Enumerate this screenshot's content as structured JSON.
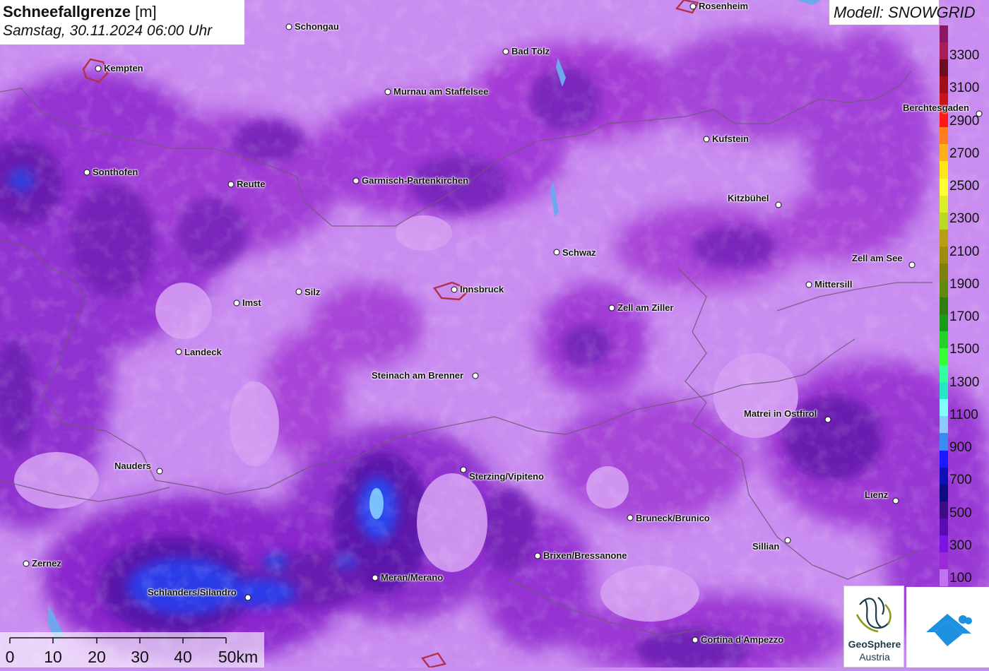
{
  "header": {
    "title": "Schneefallgrenze",
    "unit": "[m]",
    "datetime": "Samstag, 30.11.2024 06:00 Uhr",
    "model": "Modell: SNOWGRID"
  },
  "legend": {
    "labels": [
      "3300",
      "3100",
      "2900",
      "2700",
      "2500",
      "2300",
      "2100",
      "1900",
      "1700",
      "1500",
      "1300",
      "1100",
      "900",
      "700",
      "500",
      "300",
      "100"
    ],
    "colors": [
      "#8b1766",
      "#a81c5a",
      "#6e0d1e",
      "#a10e1a",
      "#c8151a",
      "#ff1a1a",
      "#ff7f1c",
      "#ffb01b",
      "#ffe61c",
      "#ffff33",
      "#dbf02a",
      "#bada22",
      "#b89e12",
      "#9b8d0d",
      "#7f7f0e",
      "#5f8a0c",
      "#2f7d0c",
      "#169c16",
      "#26d126",
      "#33ff33",
      "#33ffa0",
      "#26e6c8",
      "#7fffff",
      "#8cc9ff",
      "#3b8cf0",
      "#1a1aff",
      "#1010b8",
      "#0c0c82",
      "#3d0b84",
      "#5a0cb4",
      "#7a14e6",
      "#9b2ad8",
      "#c274f0"
    ]
  },
  "cities": [
    {
      "name": "Rosenheim",
      "dot": [
        981,
        9
      ],
      "label": [
        989,
        1
      ]
    },
    {
      "name": "Schongau",
      "dot": [
        409,
        38
      ],
      "label": [
        417,
        30
      ]
    },
    {
      "name": "Kempten",
      "dot": [
        139,
        97
      ],
      "label": [
        147,
        89
      ]
    },
    {
      "name": "Bad Tölz",
      "dot": [
        716,
        73
      ],
      "label": [
        724,
        65
      ]
    },
    {
      "name": "Murnau am Staffelsee",
      "dot": [
        549,
        130
      ],
      "label": [
        557,
        122
      ]
    },
    {
      "name": "Berchtesgaden",
      "dot": [
        1386,
        161
      ],
      "label": [
        1278,
        145
      ]
    },
    {
      "name": "Kufstein",
      "dot": [
        1000,
        197
      ],
      "label": [
        1008,
        189
      ]
    },
    {
      "name": "Sonthofen",
      "dot": [
        123,
        244
      ],
      "label": [
        131,
        236
      ]
    },
    {
      "name": "Reutte",
      "dot": [
        327,
        261
      ],
      "label": [
        335,
        253
      ]
    },
    {
      "name": "Garmisch-Partenkirchen",
      "dot": [
        504,
        256
      ],
      "label": [
        512,
        248
      ]
    },
    {
      "name": "Kitzbühel",
      "dot": [
        1102,
        290
      ],
      "label": [
        1030,
        273
      ]
    },
    {
      "name": "Schwaz",
      "dot": [
        788,
        357
      ],
      "label": [
        796,
        350
      ]
    },
    {
      "name": "Zell am See",
      "dot": [
        1291,
        375
      ],
      "label": [
        1206,
        358
      ]
    },
    {
      "name": "Mittersill",
      "dot": [
        1145,
        403
      ],
      "label": [
        1153,
        395
      ]
    },
    {
      "name": "Innsbruck",
      "dot": [
        643,
        410
      ],
      "label": [
        651,
        402
      ]
    },
    {
      "name": "Silz",
      "dot": [
        423,
        413
      ],
      "label": [
        431,
        406
      ]
    },
    {
      "name": "Imst",
      "dot": [
        335,
        429
      ],
      "label": [
        343,
        421
      ]
    },
    {
      "name": "Zell am Ziller",
      "dot": [
        866,
        436
      ],
      "label": [
        874,
        428
      ]
    },
    {
      "name": "Landeck",
      "dot": [
        253,
        498
      ],
      "label": [
        261,
        491
      ]
    },
    {
      "name": "Steinach am Brenner",
      "dot": [
        673,
        532
      ],
      "label": [
        526,
        524
      ]
    },
    {
      "name": "Matrei in Ostfirol",
      "dot": [
        1172,
        594
      ],
      "label": [
        1053,
        578
      ]
    },
    {
      "name": "Nauders",
      "dot": [
        226,
        667
      ],
      "label": [
        162,
        652
      ]
    },
    {
      "name": "Sterzing/Vipiteno",
      "dot": [
        656,
        665
      ],
      "label": [
        664,
        667
      ]
    },
    {
      "name": "Lienz",
      "dot": [
        1268,
        709
      ],
      "label": [
        1224,
        693
      ]
    },
    {
      "name": "Bruneck/Brunico",
      "dot": [
        892,
        733
      ],
      "label": [
        900,
        726
      ]
    },
    {
      "name": "Sillian",
      "dot": [
        1115,
        765
      ],
      "label": [
        1065,
        766
      ]
    },
    {
      "name": "Brixen/Bressanone",
      "dot": [
        761,
        787
      ],
      "label": [
        769,
        779
      ]
    },
    {
      "name": "Zernez",
      "dot": [
        37,
        798
      ],
      "label": [
        45,
        790
      ]
    },
    {
      "name": "Meran/Merano",
      "dot": [
        531,
        818
      ],
      "label": [
        539,
        810
      ]
    },
    {
      "name": "Schlanders/Silandro",
      "dot": [
        351,
        846
      ],
      "label": [
        209,
        831
      ]
    },
    {
      "name": "Cortina d'Ampezzo",
      "dot": [
        984,
        906
      ],
      "label": [
        992,
        898
      ]
    }
  ],
  "scale": {
    "labels": [
      "0",
      "10",
      "20",
      "30",
      "40",
      "50km"
    ]
  },
  "logos": {
    "geosphere_line1": "GeoSphere",
    "geosphere_line2": "Austria"
  }
}
